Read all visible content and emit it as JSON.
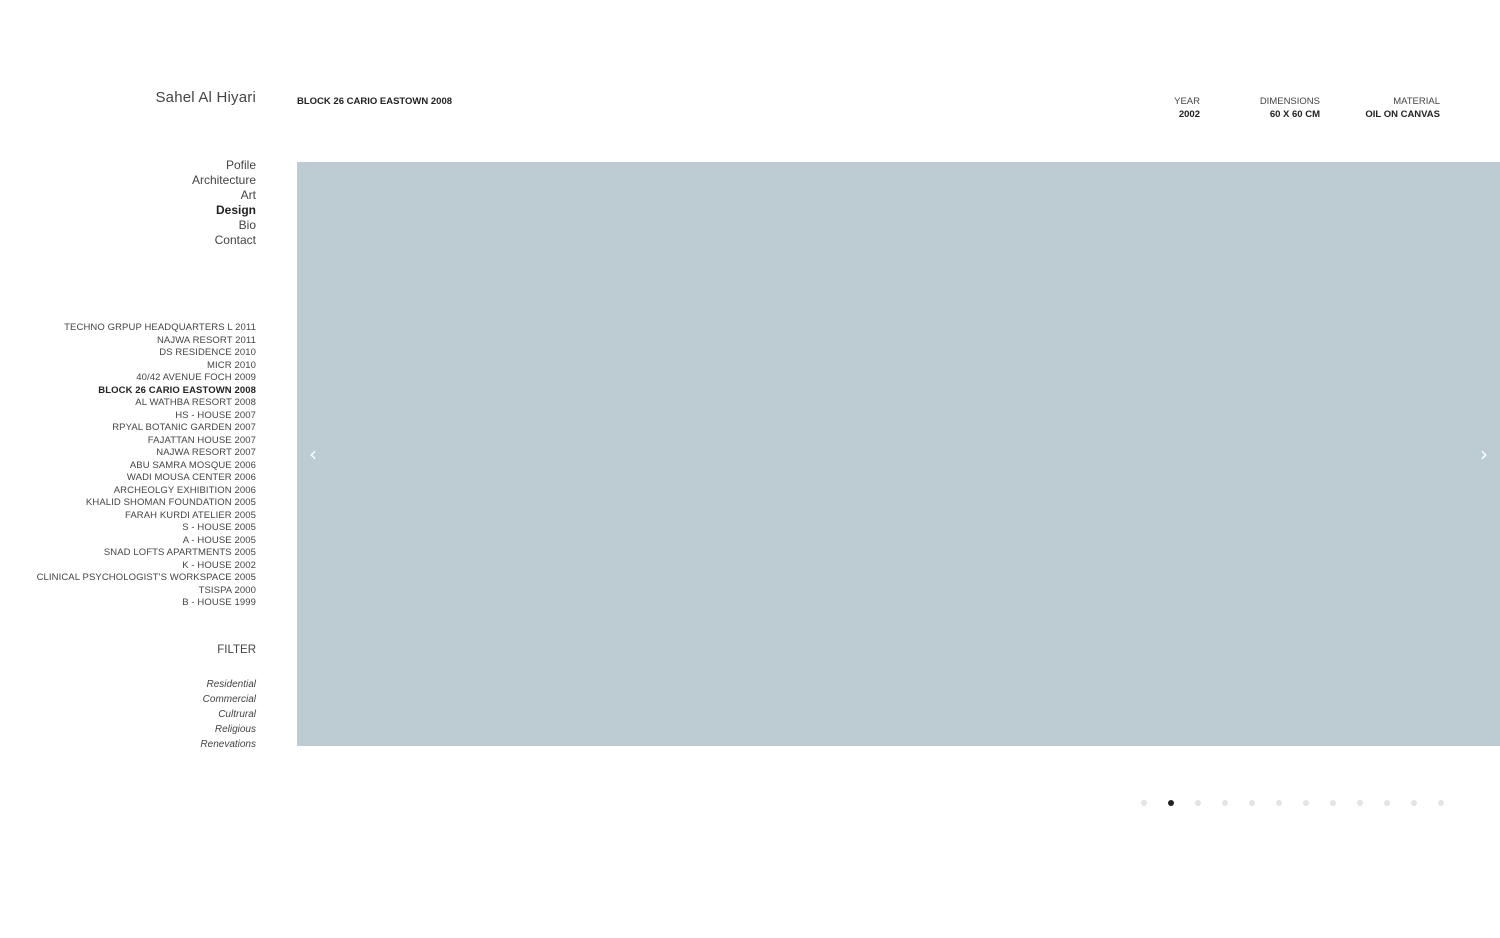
{
  "site": {
    "name": "Sahel Al Hiyari"
  },
  "nav": {
    "items": [
      {
        "label": "Pofile",
        "active": false
      },
      {
        "label": "Architecture",
        "active": false
      },
      {
        "label": "Art",
        "active": false
      },
      {
        "label": "Design",
        "active": true
      },
      {
        "label": "Bio",
        "active": false
      },
      {
        "label": "Contact",
        "active": false
      }
    ]
  },
  "projects": {
    "items": [
      {
        "label": "TECHNO GRPUP HEADQUARTERS L 2011",
        "active": false
      },
      {
        "label": "NAJWA RESORT 2011",
        "active": false
      },
      {
        "label": "DS RESIDENCE 2010",
        "active": false
      },
      {
        "label": "MICR 2010",
        "active": false
      },
      {
        "label": "40/42 AVENUE FOCH 2009",
        "active": false
      },
      {
        "label": "BLOCK 26 CARIO EASTOWN 2008",
        "active": true
      },
      {
        "label": "AL WATHBA RESORT 2008",
        "active": false
      },
      {
        "label": "HS - HOUSE 2007",
        "active": false
      },
      {
        "label": "RPYAL BOTANIC GARDEN 2007",
        "active": false
      },
      {
        "label": "FAJATTAN HOUSE 2007",
        "active": false
      },
      {
        "label": "NAJWA RESORT 2007",
        "active": false
      },
      {
        "label": "ABU SAMRA MOSQUE 2006",
        "active": false
      },
      {
        "label": "WADI MOUSA CENTER 2006",
        "active": false
      },
      {
        "label": "ARCHEOLGY EXHIBITION 2006",
        "active": false
      },
      {
        "label": "KHALID SHOMAN FOUNDATION 2005",
        "active": false
      },
      {
        "label": "FARAH KURDI ATELIER 2005",
        "active": false
      },
      {
        "label": "S - HOUSE 2005",
        "active": false
      },
      {
        "label": "A - HOUSE 2005",
        "active": false
      },
      {
        "label": "SNAD LOFTS APARTMENTS 2005",
        "active": false
      },
      {
        "label": "K - HOUSE 2002",
        "active": false
      },
      {
        "label": "CLINICAL PSYCHOLOGIST'S WORKSPACE 2005",
        "active": false
      },
      {
        "label": "TSISPA 2000",
        "active": false
      },
      {
        "label": "B - HOUSE 1999",
        "active": false
      }
    ]
  },
  "filter": {
    "title": "FILTER",
    "items": [
      "Residential",
      "Commercial",
      "Cultrural",
      "Religious",
      "Renevations"
    ]
  },
  "project_header": {
    "title": "BLOCK 26 CARIO EASTOWN 2008",
    "year_label": "YEAR",
    "year_value": "2002",
    "dimensions_label": "DIMENSIONS",
    "dimensions_value": "60 X 60 CM",
    "material_label": "MATERIAL",
    "material_value": "OIL ON CANVAS"
  },
  "slideshow": {
    "background_color": "#bdcbd3",
    "prev_icon": "chevron-left-icon",
    "next_icon": "chevron-right-icon",
    "prev_glyph": "‹",
    "next_glyph": "›",
    "slide_count": 12,
    "active_slide": 2
  },
  "colors": {
    "text": "#444444",
    "active_text": "#222222",
    "dot_inactive": "#e4e4e4",
    "dot_active": "#222222"
  }
}
